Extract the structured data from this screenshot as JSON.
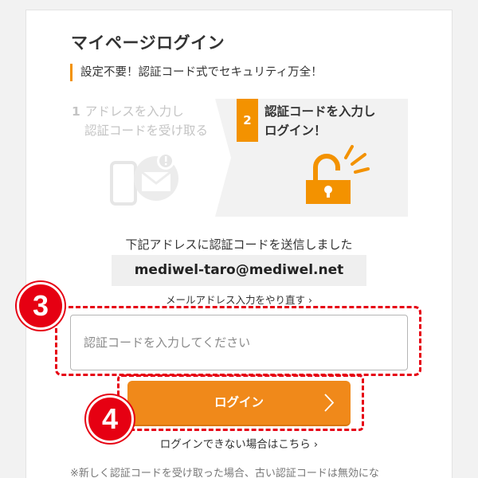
{
  "page": {
    "title": "マイページログイン",
    "subtitle": "設定不要！認証コード式でセキュリティ万全！"
  },
  "steps": [
    {
      "number": "1",
      "line1": "アドレスを入力し",
      "line2": "認証コードを受け取る",
      "state": "inactive",
      "illustration": "phone-mail-icon"
    },
    {
      "number": "2",
      "line1": "認証コードを入力し",
      "line2": "ログイン！",
      "state": "active",
      "illustration": "unlocked-padlock-icon"
    }
  ],
  "sent_message": "下記アドレスに認証コードを送信しました",
  "email": "mediwel-taro@mediwel.net",
  "redo_link": {
    "label": "メールアドレス入力をやり直す",
    "chevron": "›"
  },
  "code_input": {
    "value": "",
    "placeholder": "認証コードを入力してください"
  },
  "login_button": {
    "label": "ログイン",
    "chevron": "›"
  },
  "cant_login_link": {
    "label": "ログインできない場合はこちら",
    "chevron": "›"
  },
  "note": "※新しく認証コードを受け取った場合、古い認証コードは無効にな",
  "annotations": [
    {
      "number": "3",
      "target": "code-input"
    },
    {
      "number": "4",
      "target": "login-button"
    }
  ],
  "colors": {
    "accent_orange": "#f39200",
    "button_orange": "#f0891a",
    "annotation_red": "#e60012",
    "inactive_gray": "#c4c4c4",
    "email_box_bg": "#efefef"
  }
}
